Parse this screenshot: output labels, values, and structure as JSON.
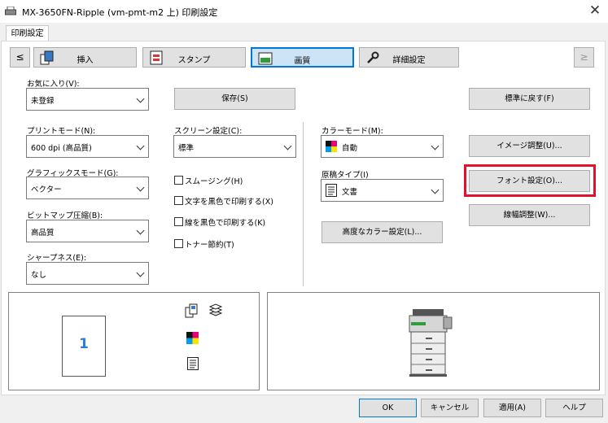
{
  "window": {
    "title": "MX-3650FN-Ripple (vm-pmt-m2 上) 印刷設定",
    "close_glyph": "✕"
  },
  "tab": {
    "label": "印刷設定"
  },
  "nav": {
    "prev_glyph": "≤",
    "next_glyph": "≥",
    "buttons": [
      {
        "label": "挿入",
        "icon": "insert-pages-icon"
      },
      {
        "label": "スタンプ",
        "icon": "stamp-icon"
      },
      {
        "label": "画質",
        "icon": "image-quality-icon",
        "selected": true
      },
      {
        "label": "詳細設定",
        "icon": "wrench-icon"
      }
    ]
  },
  "favorites": {
    "label": "お気に入り(V):",
    "value": "未登録",
    "save_label": "保存(S)",
    "reset_label": "標準に戻す(F)"
  },
  "print_mode": {
    "label": "プリントモード(N):",
    "value": "600 dpi (高品質)"
  },
  "graphics_mode": {
    "label": "グラフィックスモード(G):",
    "value": "ベクター"
  },
  "bitmap": {
    "label": "ビットマップ圧縮(B):",
    "value": "高品質"
  },
  "sharpness": {
    "label": "シャープネス(E):",
    "value": "なし"
  },
  "screen": {
    "label": "スクリーン設定(C):",
    "value": "標準"
  },
  "checks": [
    {
      "label": "スムージング(H)",
      "checked": false
    },
    {
      "label": "文字を黒色で印刷する(X)",
      "checked": false
    },
    {
      "label": "線を黒色で印刷する(K)",
      "checked": false
    },
    {
      "label": "トナー節約(T)",
      "checked": false
    }
  ],
  "color_mode": {
    "label": "カラーモード(M):",
    "value": "自動"
  },
  "original_type": {
    "label": "原稿タイプ(I)",
    "value": "文書"
  },
  "advanced_color_label": "高度なカラー設定(L)...",
  "image_adjust_label": "イメージ調整(U)...",
  "font_settings_label": "フォント設定(O)...",
  "line_width_label": "線幅調整(W)...",
  "preview": {
    "page_number": "1"
  },
  "footer": {
    "ok": "OK",
    "cancel": "キャンセル",
    "apply": "適用(A)",
    "help": "ヘルプ"
  },
  "colors": {
    "accent": "#0078d7",
    "highlight": "#e4112b",
    "page_number": "#2a7fd4"
  }
}
